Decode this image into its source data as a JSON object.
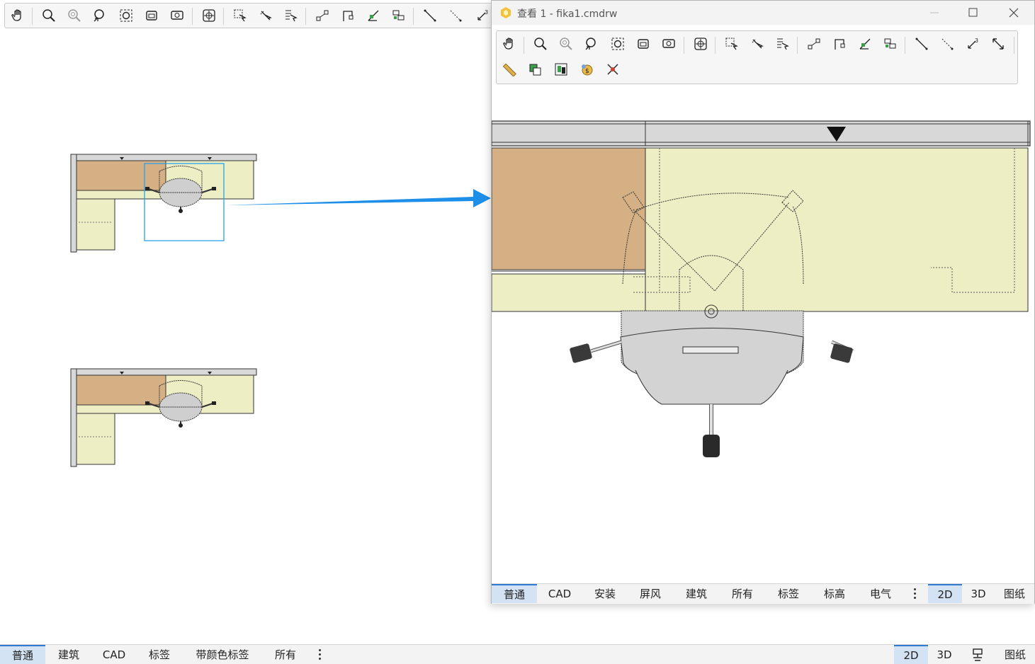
{
  "main": {
    "bottom_tabs": [
      {
        "label": "普通",
        "active": true
      },
      {
        "label": "建筑",
        "active": false
      },
      {
        "label": "CAD",
        "active": false
      },
      {
        "label": "标签",
        "active": false
      },
      {
        "label": "带颜色标签",
        "active": false
      },
      {
        "label": "所有",
        "active": false
      }
    ],
    "view_modes": [
      {
        "label": "2D",
        "active": true
      },
      {
        "label": "3D",
        "active": false
      },
      {
        "label": "图纸",
        "active": false
      }
    ]
  },
  "view_window": {
    "title": "查看 1 - fika1.cmdrw",
    "bottom_tabs": [
      {
        "label": "普通",
        "active": true
      },
      {
        "label": "CAD",
        "active": false
      },
      {
        "label": "安装",
        "active": false
      },
      {
        "label": "屏风",
        "active": false
      },
      {
        "label": "建筑",
        "active": false
      },
      {
        "label": "所有",
        "active": false
      },
      {
        "label": "标签",
        "active": false
      },
      {
        "label": "标高",
        "active": false
      },
      {
        "label": "电气",
        "active": false
      }
    ],
    "view_modes": [
      {
        "label": "2D",
        "active": true
      },
      {
        "label": "3D",
        "active": false
      },
      {
        "label": "图纸",
        "active": false
      }
    ]
  },
  "colors": {
    "desk_wood": "#d4b084",
    "desk_surface": "#eeeec5",
    "selection_blue": "#2aa0e8",
    "arrow_blue": "#1e8fe8",
    "tab_active": "#d3e3f3"
  },
  "icons": {
    "toolbar": [
      "pan-hand-icon",
      "zoom-icon",
      "zoom-fine-icon",
      "zoom-out-icon",
      "zoom-extents-icon",
      "zoom-window-icon",
      "zoom-previous-icon",
      "center-icon",
      "select-icon",
      "deselect-icon",
      "select-all-icon",
      "connect-icon",
      "align-icon",
      "rotate-icon",
      "arrange-icon",
      "measure-line-icon",
      "measure-dotted-icon",
      "dimension-icon",
      "stretch-icon"
    ],
    "view_toolbar_row2": [
      "ruler-icon",
      "copy-icon",
      "group-icon",
      "price-icon",
      "delete-icon"
    ]
  }
}
